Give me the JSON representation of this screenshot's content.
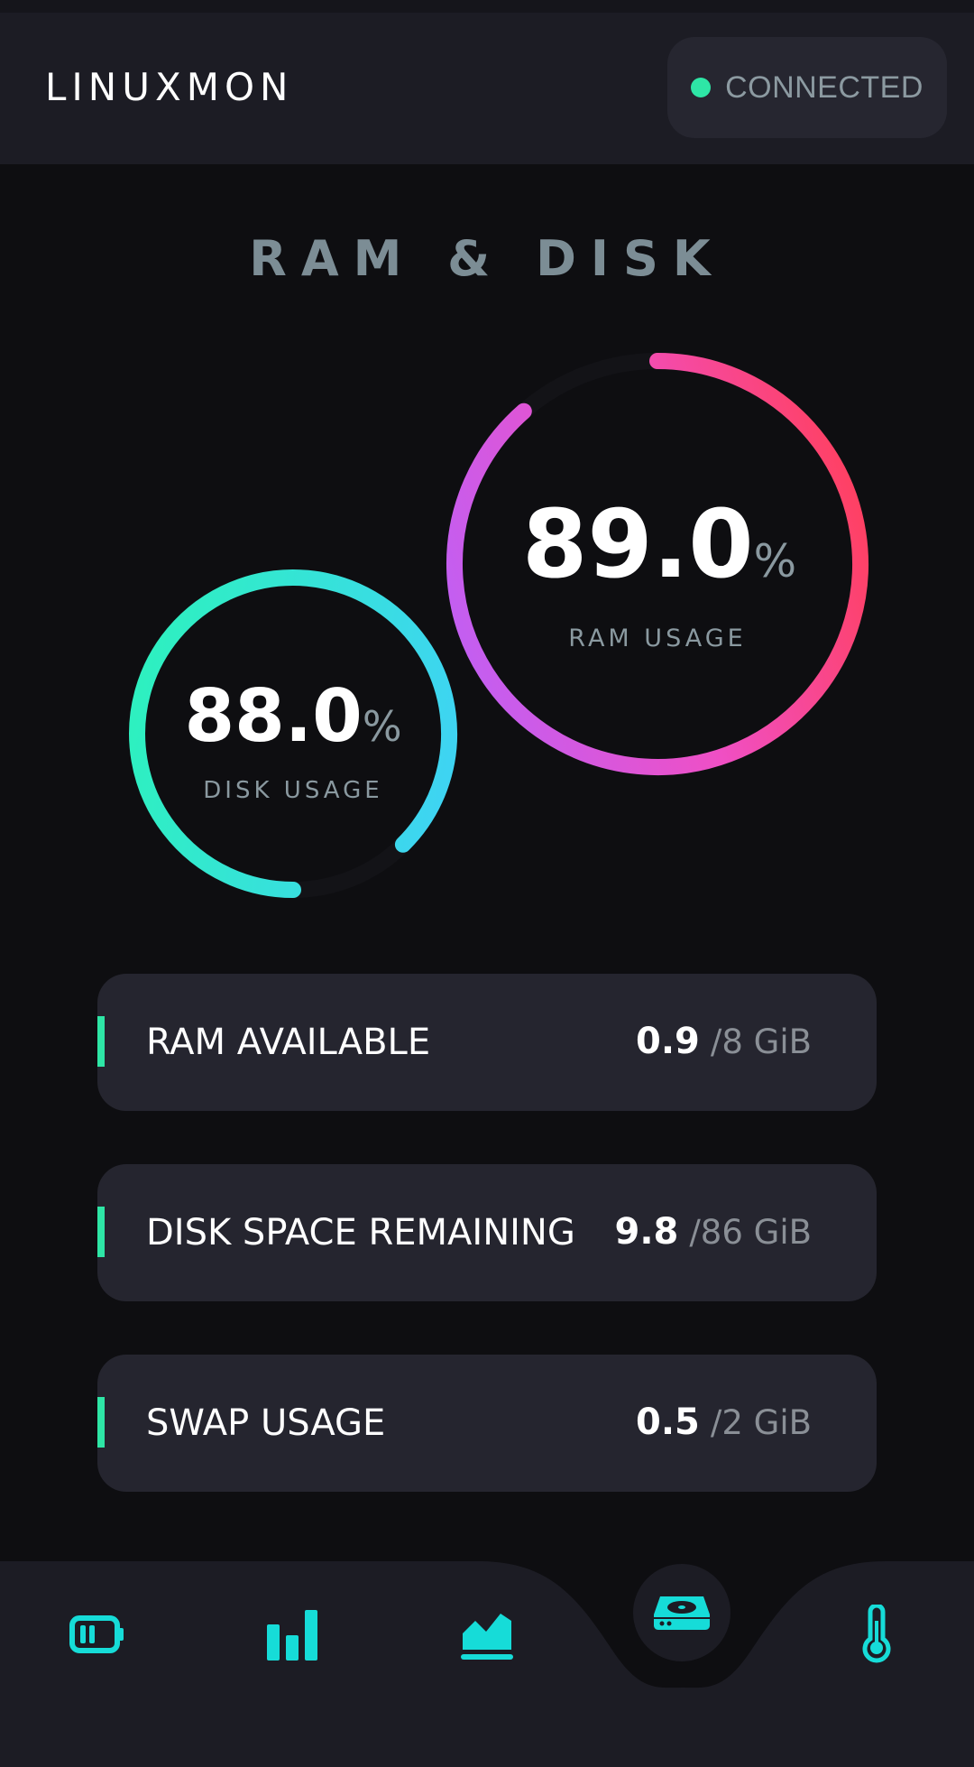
{
  "app": {
    "title": "LINUXMON"
  },
  "status": {
    "text": "CONNECTED",
    "color": "#2ee6a6"
  },
  "section": {
    "title": "RAM & DISK"
  },
  "gauges": {
    "ram": {
      "value": "89.0",
      "unit": "%",
      "label": "RAM USAGE",
      "percent": 89.0
    },
    "disk": {
      "value": "88.0",
      "unit": "%",
      "label": "DISK USAGE",
      "percent": 88.0
    }
  },
  "stats": [
    {
      "label": "RAM AVAILABLE",
      "value": "0.9",
      "total": "/8 GiB"
    },
    {
      "label": "DISK SPACE REMAINING",
      "value": "9.8",
      "total": "/86 GiB"
    },
    {
      "label": "SWAP USAGE",
      "value": "0.5",
      "total": "/2 GiB"
    }
  ],
  "nav": {
    "items": [
      {
        "icon": "battery-icon",
        "active": false
      },
      {
        "icon": "bar-chart-icon",
        "active": false
      },
      {
        "icon": "area-chart-icon",
        "active": false
      },
      {
        "icon": "disk-drive-icon",
        "active": true
      },
      {
        "icon": "thermometer-icon",
        "active": false
      }
    ]
  },
  "colors": {
    "accent": "#16dcd8",
    "ram_gradient": [
      "#ff3b5c",
      "#f04fc8",
      "#c65cf0"
    ],
    "disk_gradient": [
      "#2ef0c0",
      "#3ed8f0"
    ]
  }
}
